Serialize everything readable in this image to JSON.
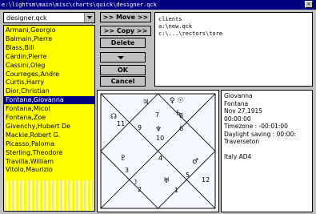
{
  "window": {
    "title": "e:\\lightsm\\main\\misc\\charts\\quick\\designer.qck"
  },
  "names_dropdown": {
    "value": "designer.qck"
  },
  "names": [
    "Armani,Georgio",
    "Balmain,Pierre",
    "Blass,Bill",
    "Cardin,Pierre",
    "Cassini,Oleg",
    "Courreges,Andre",
    "Curtis,Harry",
    "Dior,Christian",
    "Fontana,Giovanna",
    "Fontana,Micol",
    "Fontana,Zoe",
    "Givenchy,Hubert De",
    "Mackie,Robert G.",
    "Picasso,Paloma",
    "Sterling,Theodore",
    "Travilla,William",
    "Vitolo,Maurizio"
  ],
  "selected_name": "Fontana,Giovanna",
  "buttons": {
    "move": ">> Move >>",
    "copy": ">> Copy >>",
    "delete": "Delete",
    "ok": "OK",
    "cancel": "Cancel"
  },
  "target_list": [
    "clients",
    "a:\\new.qck",
    "c:\\...\\rectors\\tore"
  ],
  "chart": {
    "houses": [
      {
        "num": "7",
        "planets": "♃"
      },
      {
        "num": "8",
        "planets": "♀ ☉"
      },
      {
        "num": "6",
        "planets": "♄"
      },
      {
        "num": "9",
        "planets": ""
      },
      {
        "num": "11",
        "planets": "☊"
      },
      {
        "num": "10",
        "planets": "♆"
      },
      {
        "num": "4",
        "planets": ""
      },
      {
        "num": "3",
        "planets": "♇"
      },
      {
        "num": "2",
        "planets": "☽"
      },
      {
        "num": "1",
        "planets": "♅"
      },
      {
        "num": "12",
        "planets": ""
      },
      {
        "num": "5",
        "planets": "♂"
      }
    ]
  },
  "info": [
    "Giovanna",
    "Fontana",
    "Nov 27,1915",
    "00:00:00",
    "Timezone : -00:01:00",
    "Daylight saving : 00:00:",
    "Traverseton",
    "",
    "Italy          AD4"
  ]
}
